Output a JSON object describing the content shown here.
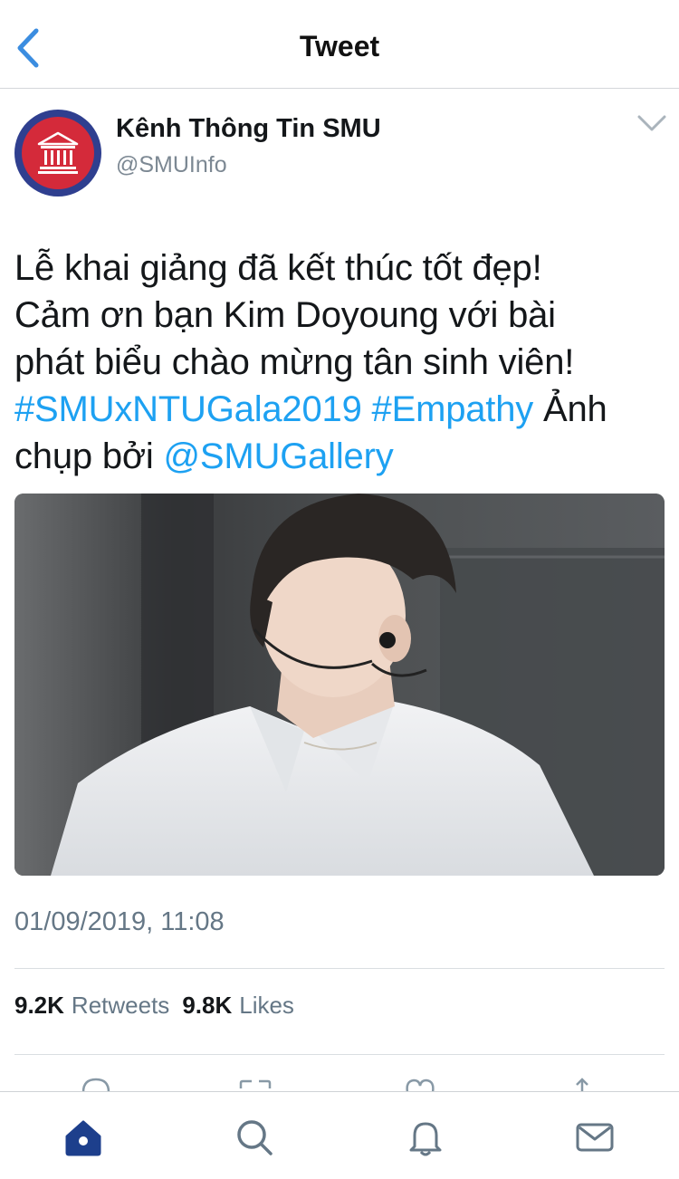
{
  "header": {
    "title": "Tweet",
    "back_icon": "chevron-left-icon"
  },
  "author": {
    "name": "Kênh Thông Tin SMU",
    "handle": "@SMUInfo",
    "avatar_icon": "building-columns-icon"
  },
  "tweet": {
    "text_line_1": "Lễ khai giảng đã kết thúc tốt đẹp!",
    "text_line_2": "Cảm ơn bạn Kim Doyoung với bài",
    "text_line_3": "phát biểu chào mừng tân sinh viên!",
    "hashtag_1": "#SMUxNTUGala2019",
    "hashtag_2": "#Empathy",
    "text_after_hashtags": " Ảnh",
    "text_before_mention": "chụp bởi ",
    "mention": "@SMUGallery",
    "timestamp": "01/09/2019, 11:08"
  },
  "stats": {
    "retweets_count": "9.2K",
    "retweets_label": "Retweets",
    "likes_count": "9.8K",
    "likes_label": "Likes"
  },
  "actions": [
    "reply-icon",
    "retweet-icon",
    "like-icon",
    "share-icon"
  ],
  "tabbar": [
    "home-icon",
    "search-icon",
    "notifications-icon",
    "messages-icon"
  ],
  "colors": {
    "accent": "#1da1f2",
    "tab_active": "#1d3f8c",
    "tab_inactive": "#657786",
    "back": "#3b8de0"
  }
}
